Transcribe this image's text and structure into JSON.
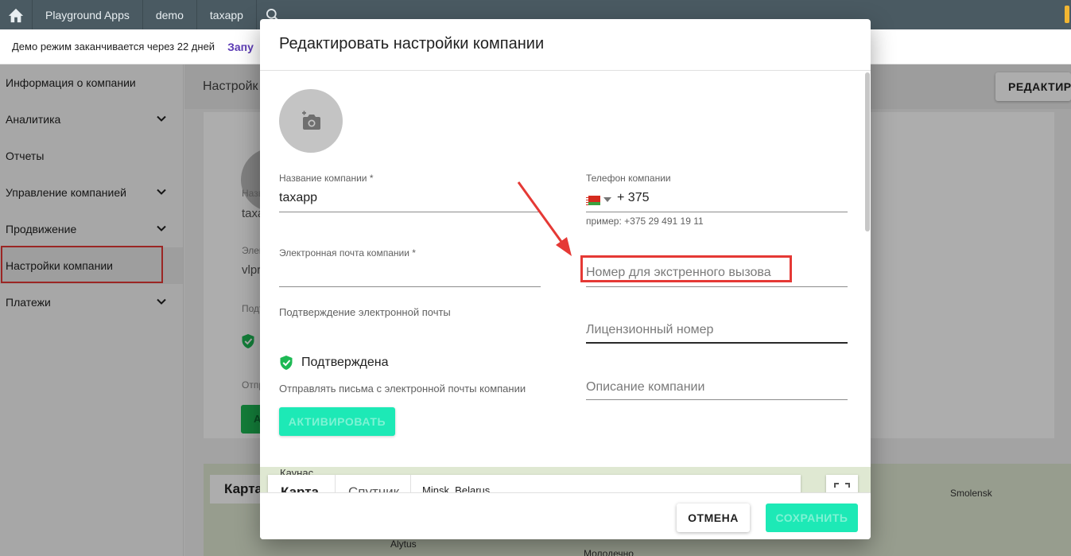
{
  "topbar": {
    "crumbs": [
      "Playground Apps",
      "demo",
      "taxapp"
    ]
  },
  "banner": {
    "text": "Демо режим заканчивается через 22 дней",
    "link": "Запу"
  },
  "sidebar": {
    "items": [
      {
        "label": "Информация о компании"
      },
      {
        "label": "Аналитика"
      },
      {
        "label": "Отчеты"
      },
      {
        "label": "Управление компанией"
      },
      {
        "label": "Продвижение"
      },
      {
        "label": "Настройки компании"
      },
      {
        "label": "Платежи"
      }
    ]
  },
  "background_page": {
    "title": "Настройк",
    "edit_button": "РЕДАКТИРО",
    "name_label": "Названи",
    "name_value": "taxapp",
    "email_label": "Электро",
    "email_value": "vlprish",
    "confirm_label": "Подтвер",
    "confirm_value": "По",
    "send_label": "Отправл",
    "activate_btn": "АКТИ",
    "map_tab": "Карта",
    "map_city_smolensk": "Smolensk",
    "map_city_alytus": "Alytus",
    "map_city_molodechno": "Молодечно"
  },
  "dialog": {
    "title": "Редактировать настройки компании",
    "company_name_label": "Название компании",
    "required_mark": "*",
    "company_name_value": "taxapp",
    "phone_label": "Телефон компании",
    "phone_code": "+ 375",
    "phone_helper": "пример: +375 29 491 19 11",
    "email_label": "Электронная почта компании",
    "email_value": "",
    "emergency_placeholder": "Номер для экстренного вызова",
    "email_confirm_label": "Подтверждение электронной почты",
    "email_confirm_status": "Подтверждена",
    "license_placeholder": "Лицензионный номер",
    "send_from_email_label": "Отправлять письма с электронной почты компании",
    "description_placeholder": "Описание компании",
    "activate_button": "АКТИВИРОВАТЬ",
    "map": {
      "city": "Каунас",
      "tab_map": "Карта",
      "tab_satellite": "Спутник",
      "address": "Minsk, Belarus"
    },
    "cancel_button": "ОТМЕНА",
    "save_button": "СОХРАНИТЬ"
  },
  "colors": {
    "accent": "#1de9b6",
    "topbar": "#4a5a62",
    "annotation": "#e53935",
    "verified": "#1db954"
  },
  "icons": [
    "home-icon",
    "search-icon",
    "chevron-down-icon",
    "camera-add-icon",
    "shield-check-icon",
    "fullscreen-icon"
  ]
}
